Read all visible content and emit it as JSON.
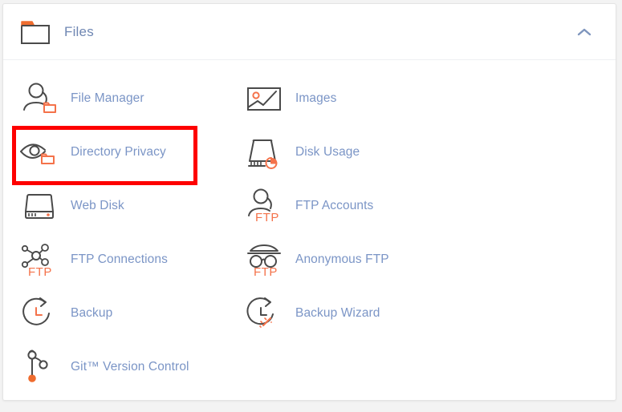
{
  "panel": {
    "title": "Files",
    "icon": "folder-icon",
    "collapse_icon": "chevron-up-icon",
    "expanded": true
  },
  "colors": {
    "accent_orange": "#f4724a",
    "link_blue": "#7b95c6",
    "title_blue": "#6f87b3",
    "icon_gray": "#4a4a4a",
    "highlight_red": "#fe0000",
    "card_bg": "#ffffff",
    "page_bg": "#f3f3f3"
  },
  "items": [
    {
      "label": "File Manager",
      "icon": "user-folder-icon",
      "column": "a",
      "highlighted": false
    },
    {
      "label": "Images",
      "icon": "picture-icon",
      "column": "b",
      "highlighted": false
    },
    {
      "label": "Directory Privacy",
      "icon": "eye-folder-icon",
      "column": "a",
      "highlighted": true
    },
    {
      "label": "Disk Usage",
      "icon": "disk-pie-icon",
      "column": "b",
      "highlighted": false
    },
    {
      "label": "Web Disk",
      "icon": "web-disk-icon",
      "column": "a",
      "highlighted": false
    },
    {
      "label": "FTP Accounts",
      "icon": "user-ftp-icon",
      "column": "b",
      "highlighted": false
    },
    {
      "label": "FTP Connections",
      "icon": "network-ftp-icon",
      "column": "a",
      "highlighted": false
    },
    {
      "label": "Anonymous FTP",
      "icon": "incognito-ftp-icon",
      "column": "b",
      "highlighted": false
    },
    {
      "label": "Backup",
      "icon": "backup-clock-icon",
      "column": "a",
      "highlighted": false
    },
    {
      "label": "Backup Wizard",
      "icon": "backup-wand-icon",
      "column": "b",
      "highlighted": false
    },
    {
      "label": "Git™ Version Control",
      "icon": "git-branch-icon",
      "column": "a",
      "highlighted": false
    }
  ],
  "highlight": {
    "target": "Directory Privacy",
    "shape": "rectangle",
    "color": "#fe0000"
  }
}
